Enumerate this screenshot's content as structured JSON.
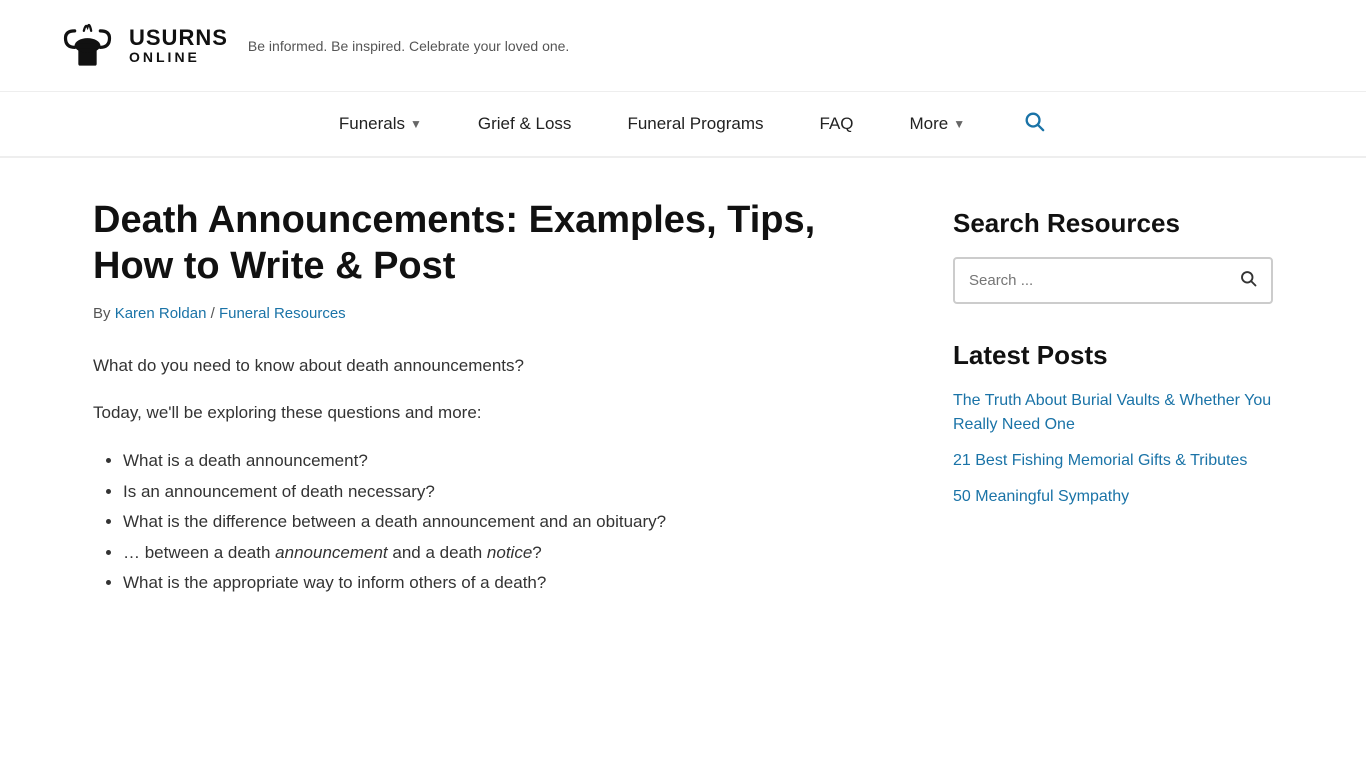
{
  "site": {
    "logo_text_line1": "USURNS",
    "logo_text_line2": "ONLINE",
    "tagline": "Be informed. Be inspired. Celebrate your loved one."
  },
  "nav": {
    "items": [
      {
        "label": "Funerals",
        "has_dropdown": true
      },
      {
        "label": "Grief & Loss",
        "has_dropdown": false
      },
      {
        "label": "Funeral Programs",
        "has_dropdown": false
      },
      {
        "label": "FAQ",
        "has_dropdown": false
      },
      {
        "label": "More",
        "has_dropdown": true
      }
    ]
  },
  "article": {
    "title": "Death Announcements: Examples, Tips, How to Write & Post",
    "meta_by": "By ",
    "meta_author": "Karen Roldan",
    "meta_separator": " / ",
    "meta_category": "Funeral Resources",
    "intro1": "What do you need to know about death announcements?",
    "intro2": "Today, we'll be exploring these questions and more:",
    "bullet1": "What is a death announcement?",
    "bullet2": "Is an announcement of death necessary?",
    "bullet3": "What is the difference between a death announcement and an obituary?",
    "bullet4_pre": "… between a death ",
    "bullet4_italic1": "announcement",
    "bullet4_mid": " and a death ",
    "bullet4_italic2": "notice",
    "bullet4_post": "?",
    "bullet5": "What is the appropriate way to inform others of a death?"
  },
  "sidebar": {
    "search_title": "Search Resources",
    "search_placeholder": "Search ...",
    "search_button_label": "Search",
    "latest_title": "Latest Posts",
    "latest_posts": [
      {
        "label": "The Truth About Burial Vaults & Whether You Really Need One",
        "href": "#"
      },
      {
        "label": "21 Best Fishing Memorial Gifts & Tributes",
        "href": "#"
      },
      {
        "label": "50 Meaningful Sympathy",
        "href": "#"
      }
    ]
  },
  "colors": {
    "link": "#1a73a7",
    "accent": "#1a73a7"
  }
}
